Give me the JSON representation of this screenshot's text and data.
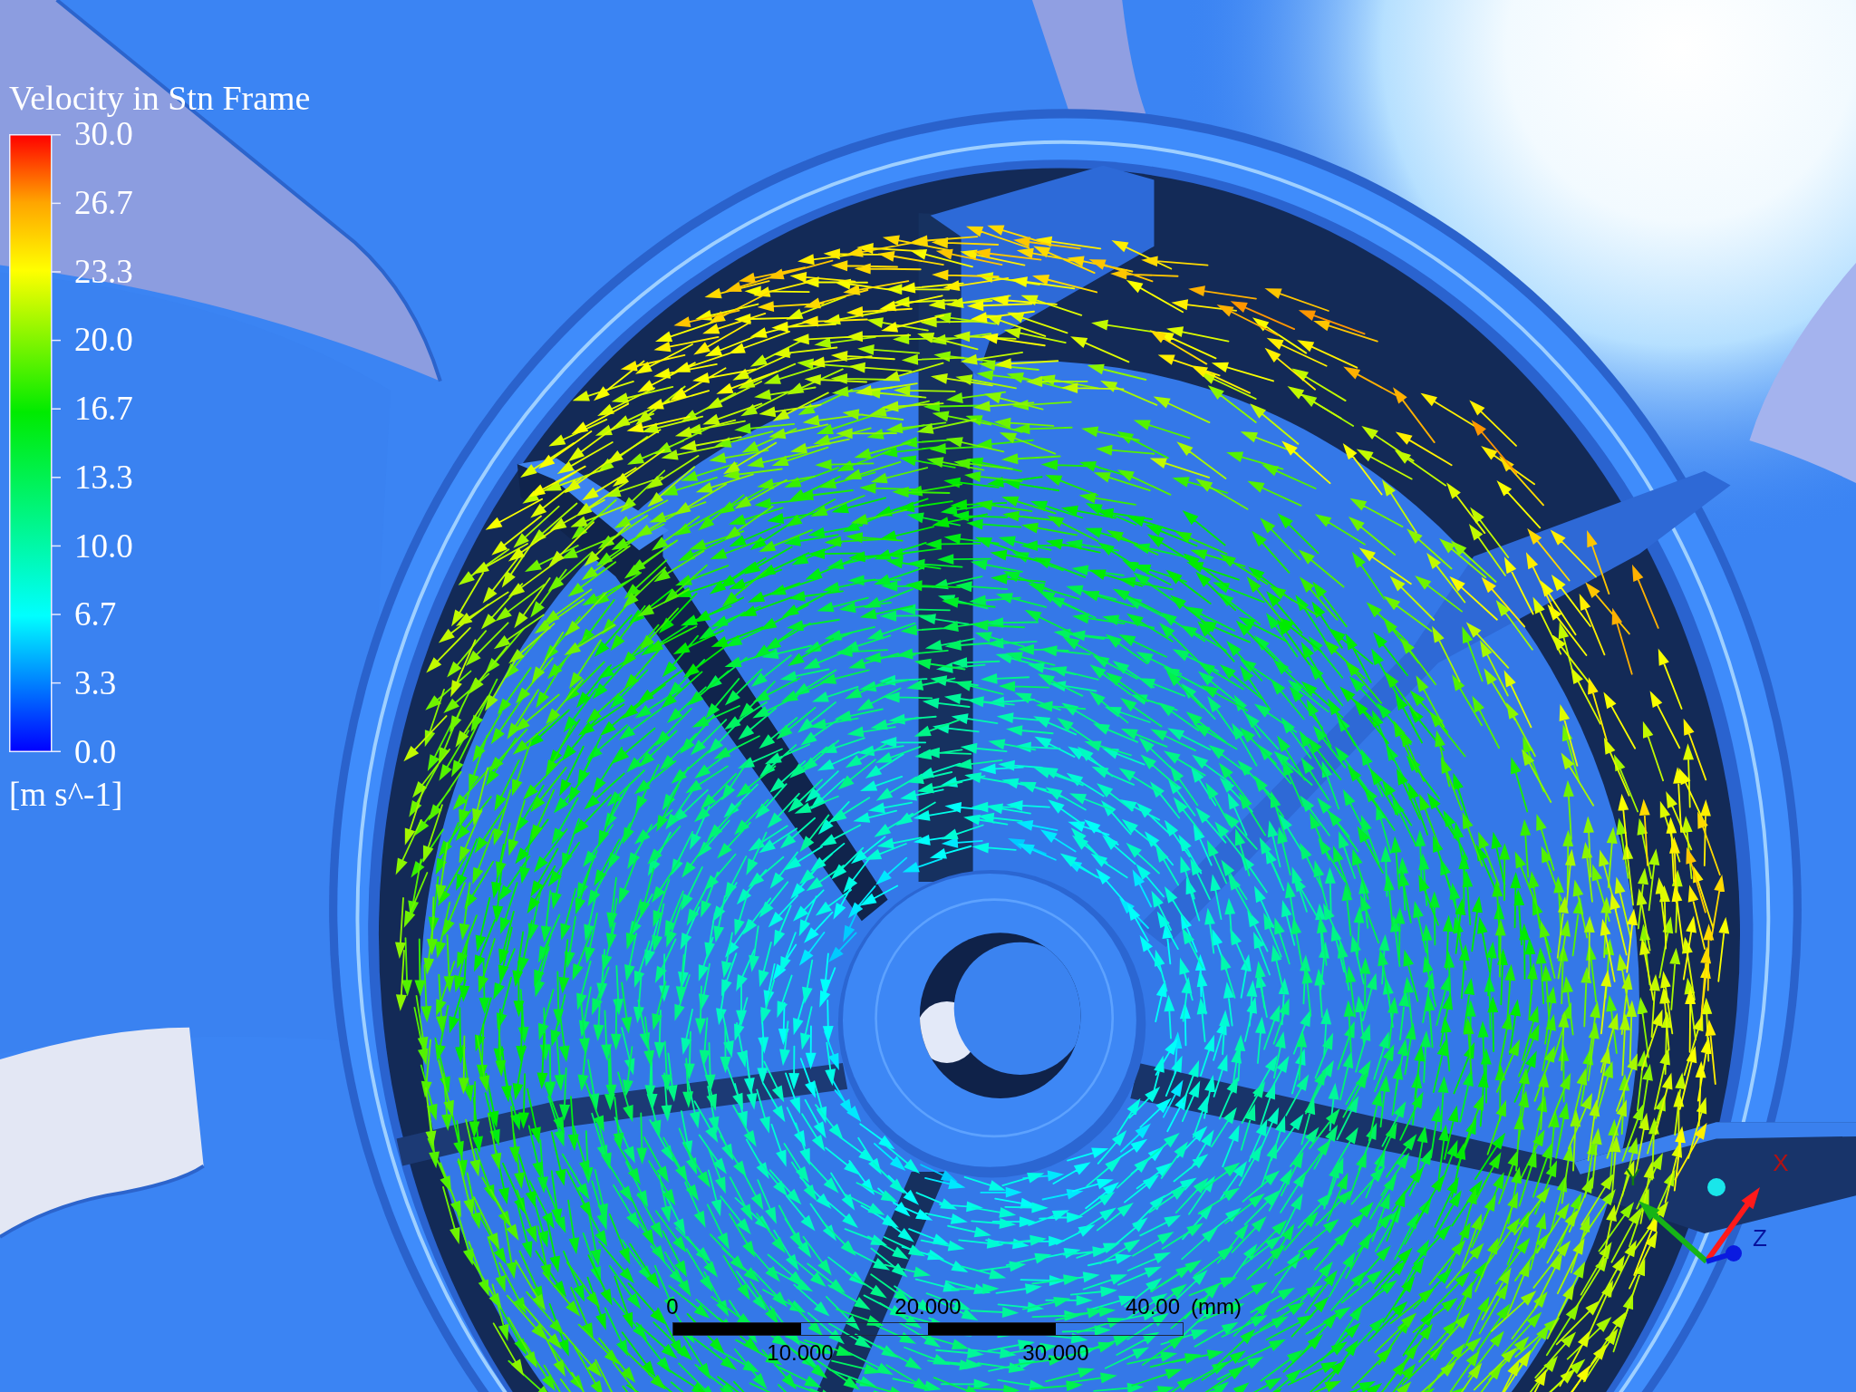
{
  "legend": {
    "title": "Velocity in Stn Frame",
    "ticks": [
      "30.0",
      "26.7",
      "23.3",
      "20.0",
      "16.7",
      "13.3",
      "10.0",
      "6.7",
      "3.3",
      "0.0"
    ],
    "unit": "[m s^-1]"
  },
  "scale_bar": {
    "top_labels": [
      "0",
      "20.000",
      "40.00"
    ],
    "unit": "(mm)",
    "bottom_labels": [
      "10.000",
      "30.000"
    ]
  },
  "axes": [
    {
      "label": "X",
      "color": "#ff1a1a",
      "kind": "cone"
    },
    {
      "label": "Y",
      "color": "#16b416",
      "kind": "cone"
    },
    {
      "label": "Z",
      "color": "#0a1ae0",
      "kind": "ball"
    }
  ]
}
